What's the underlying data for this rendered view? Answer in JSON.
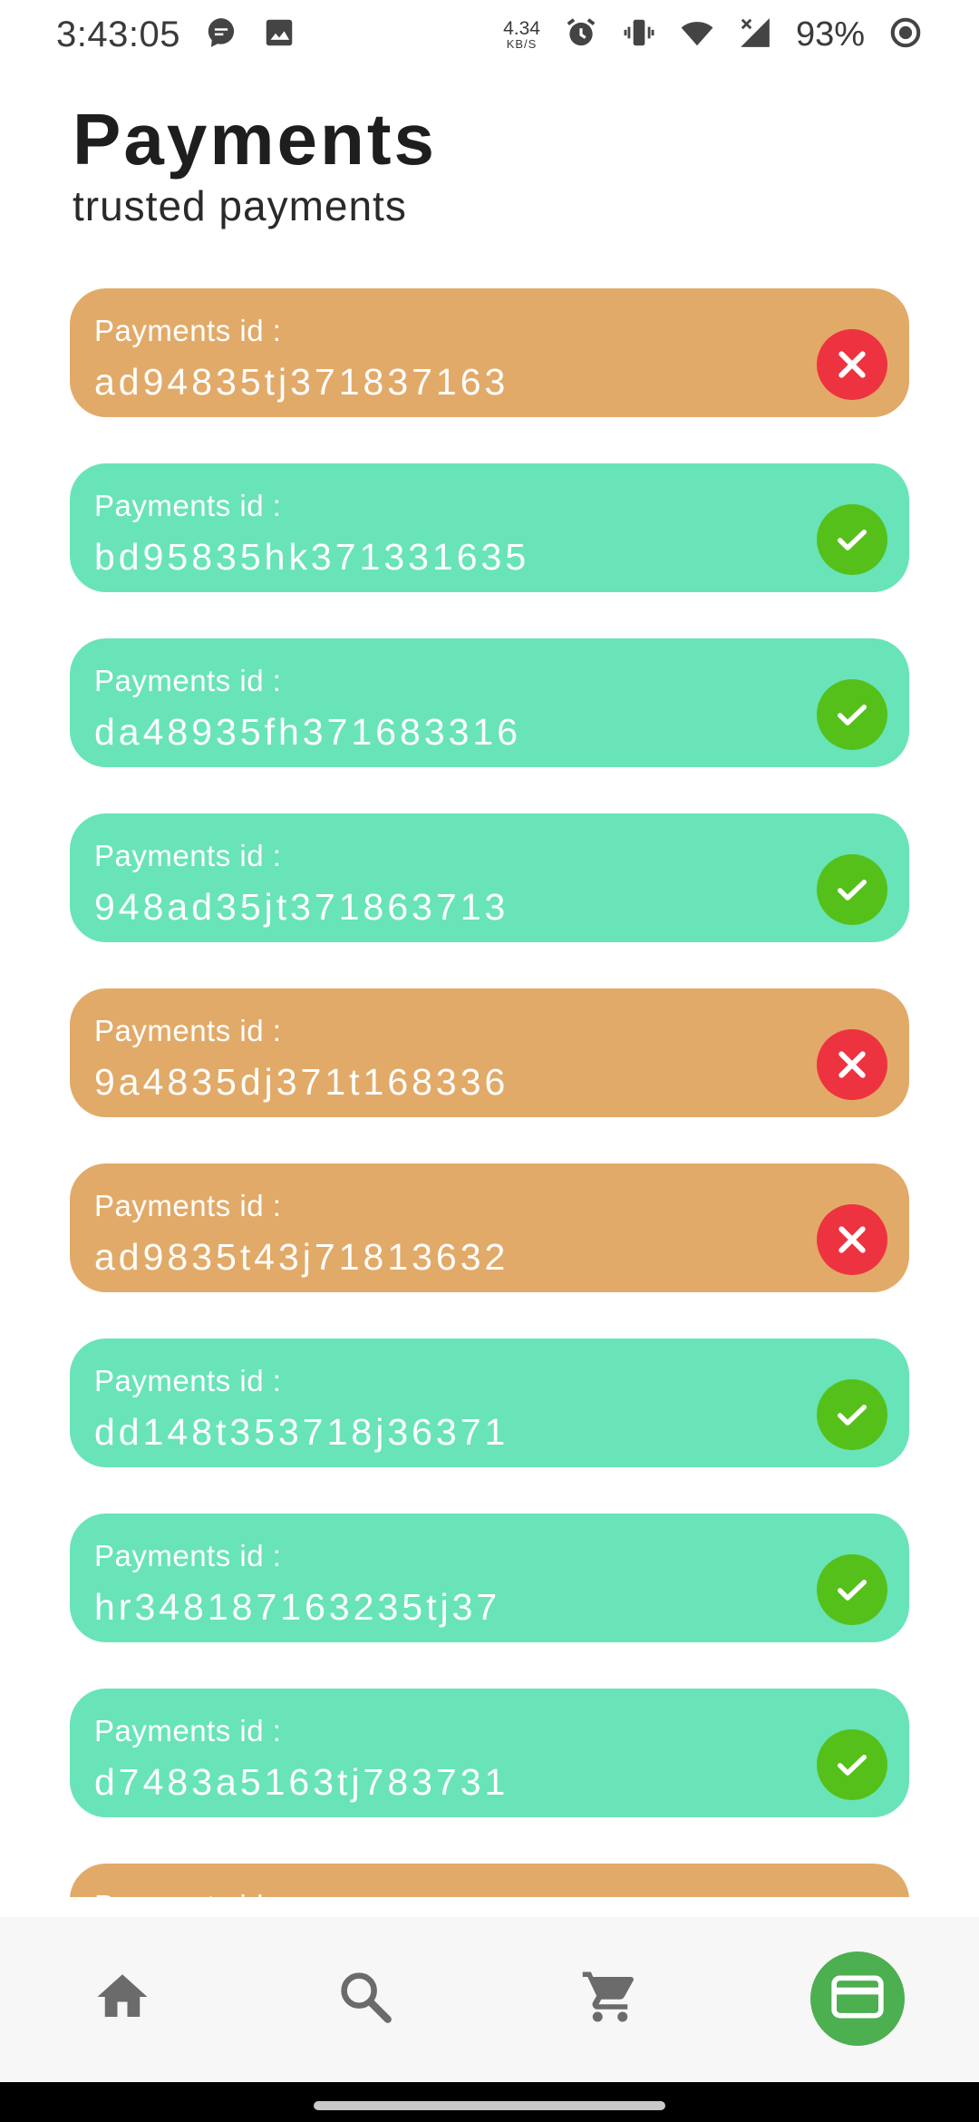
{
  "status_bar": {
    "time": "3:43:05",
    "net_speed": "4.34",
    "net_unit": "KB/S",
    "battery": "93%",
    "icons": [
      "message-icon",
      "image-icon",
      "alarm-icon",
      "vibrate-icon",
      "wifi-icon",
      "signal-icon",
      "battery-saver-icon"
    ]
  },
  "header": {
    "title": "Payments",
    "subtitle": "trusted payments"
  },
  "payments": [
    {
      "label": "Payments id :",
      "id": "ad94835tj371837163",
      "status": "failed"
    },
    {
      "label": "Payments id :",
      "id": "bd95835hk371331635",
      "status": "success"
    },
    {
      "label": "Payments id :",
      "id": "da48935fh371683316",
      "status": "success"
    },
    {
      "label": "Payments id :",
      "id": "948ad35jt371863713",
      "status": "success"
    },
    {
      "label": "Payments id :",
      "id": "9a4835dj371t168336",
      "status": "failed"
    },
    {
      "label": "Payments id :",
      "id": "ad9835t43j71813632",
      "status": "failed"
    },
    {
      "label": "Payments id :",
      "id": "dd148t353718j36371",
      "status": "success"
    },
    {
      "label": "Payments id :",
      "id": "hr348187163235tj37",
      "status": "success"
    },
    {
      "label": "Payments id :",
      "id": "d7483a5163tj783731",
      "status": "success"
    },
    {
      "label": "Payments id :",
      "id": "",
      "status": "failed"
    }
  ],
  "bottom_nav": {
    "items": [
      {
        "icon": "home-icon",
        "active": false
      },
      {
        "icon": "search-icon",
        "active": false
      },
      {
        "icon": "cart-icon",
        "active": false
      },
      {
        "icon": "payment-card-icon",
        "active": true
      }
    ]
  },
  "colors": {
    "failed_card": "#e2aa68",
    "success_card": "#68e4b8",
    "failed_icon": "#ee3340",
    "success_icon": "#56c01a",
    "nav_active": "#4caf50",
    "nav_icon": "#6b6b6b"
  }
}
